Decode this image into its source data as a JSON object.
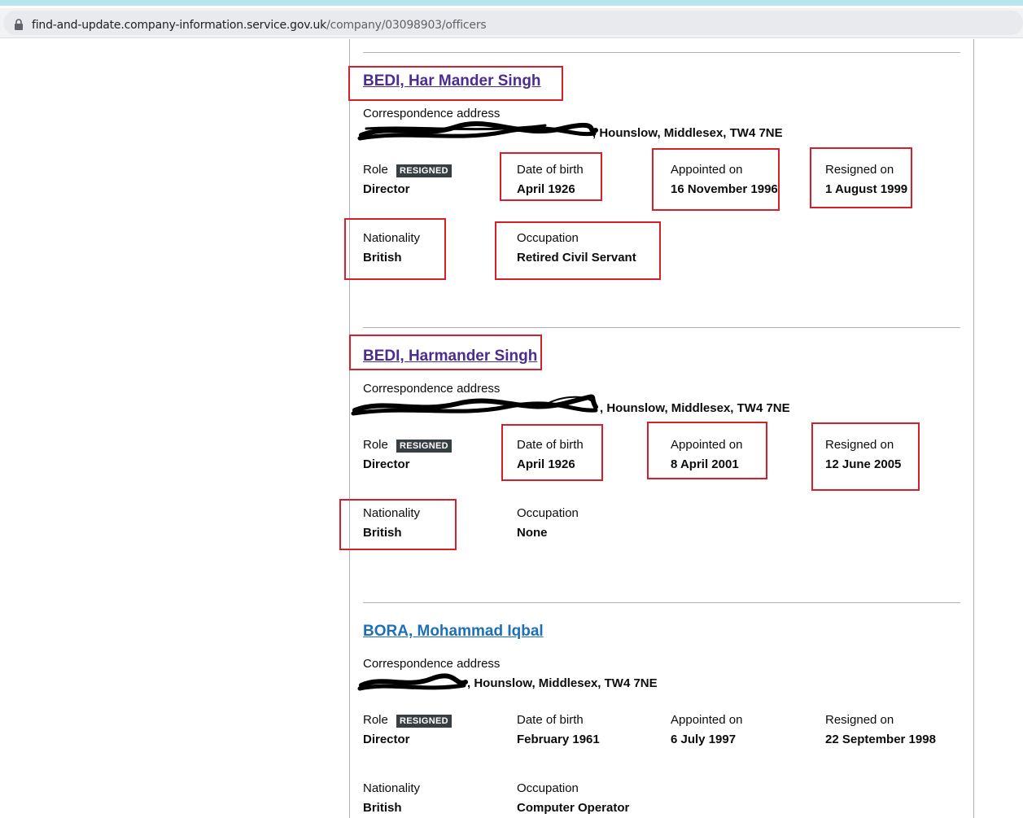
{
  "browser": {
    "url_domain": "find-and-update.company-information.service.gov.uk",
    "url_path": "/company/03098903/officers"
  },
  "labels": {
    "correspondence": "Correspondence address",
    "role": "Role",
    "dob": "Date of birth",
    "appointed": "Appointed on",
    "resigned": "Resigned on",
    "nationality": "Nationality",
    "occupation": "Occupation"
  },
  "officers": [
    {
      "name": "BEDI, Har Mander Singh",
      "address_visible": ", Hounslow, Middlesex, TW4 7NE",
      "status_badge": "RESIGNED",
      "role": "Director",
      "dob": "April 1926",
      "appointed": "16 November 1996",
      "resigned": "1 August 1999",
      "nationality": "British",
      "occupation": "Retired Civil Servant"
    },
    {
      "name": "BEDI, Harmander Singh",
      "address_visible": ", Hounslow, Middlesex, TW4 7NE",
      "status_badge": "RESIGNED",
      "role": "Director",
      "dob": "April 1926",
      "appointed": "8 April 2001",
      "resigned": "12 June 2005",
      "nationality": "British",
      "occupation": "None"
    },
    {
      "name": "BORA, Mohammad Iqbal",
      "address_visible": ", Hounslow, Middlesex, TW4 7NE",
      "status_badge": "RESIGNED",
      "role": "Director",
      "dob": "February 1961",
      "appointed": "6 July 1997",
      "resigned": "22 September 1998",
      "nationality": "British",
      "occupation": "Computer Operator"
    }
  ],
  "colors": {
    "visited_link": "#4c2c92",
    "link": "#1d70b8",
    "badge_bg": "#383f43",
    "annotation_box": "#d4202b"
  }
}
